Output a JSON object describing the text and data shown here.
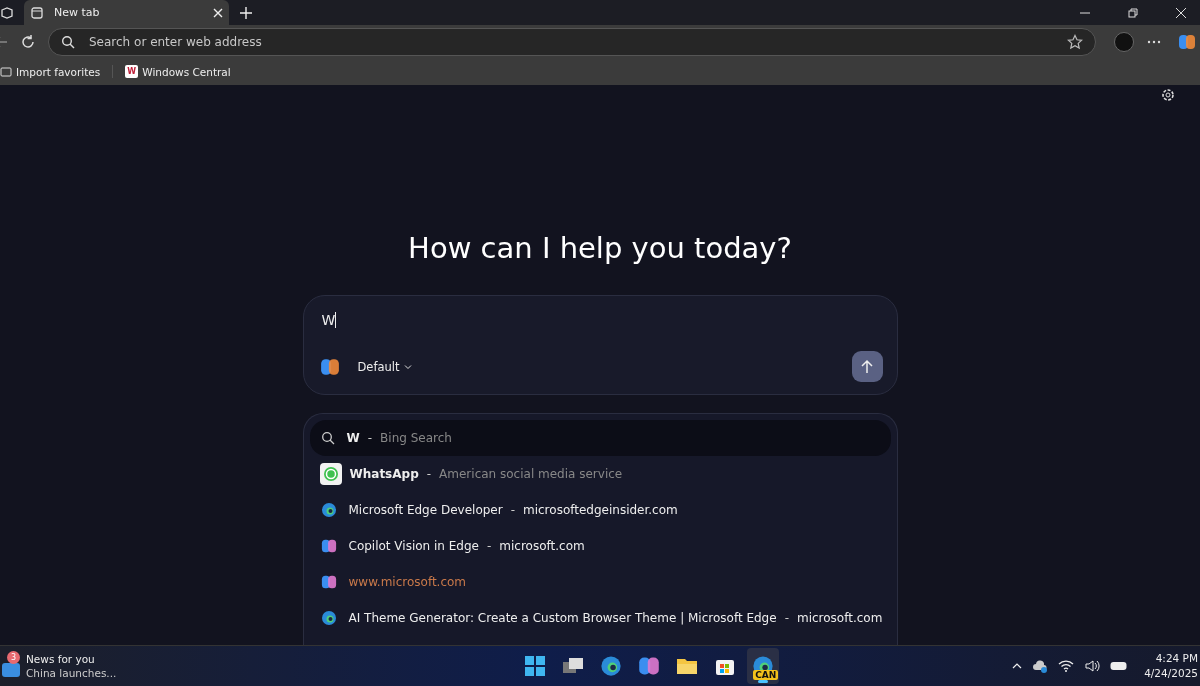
{
  "tabs": [
    {
      "title": "New tab",
      "selected": true
    }
  ],
  "address_bar": {
    "placeholder": "Search or enter web address"
  },
  "favorites": [
    {
      "label": "Import favorites",
      "kind": "import"
    },
    {
      "label": "Windows Central",
      "kind": "site",
      "badge": "W"
    }
  ],
  "heading": "How can I help you today?",
  "composer": {
    "value": "W",
    "mode": "Default"
  },
  "suggestions": [
    {
      "kind": "query",
      "title": "W",
      "separator": "-",
      "detail": "Bing Search",
      "selected": true
    },
    {
      "kind": "entity",
      "title": "WhatsApp",
      "separator": "-",
      "detail": "American social media service",
      "selected": false
    },
    {
      "kind": "edge",
      "title": "Microsoft Edge Developer",
      "separator": "-",
      "detail": "microsoftedgeinsider.com",
      "selected": false
    },
    {
      "kind": "copilot",
      "title": "Copilot Vision in Edge",
      "separator": "-",
      "detail": "microsoft.com",
      "selected": false
    },
    {
      "kind": "address",
      "title": "www.microsoft.com",
      "selected": false
    },
    {
      "kind": "edge",
      "title": "AI Theme Generator: Create a Custom Browser Theme | Microsoft Edge",
      "separator": "-",
      "detail": "microsoft.com",
      "selected": false
    }
  ],
  "taskbar": {
    "news": {
      "title": "News for you",
      "subtitle": "China launches...",
      "badge": "3"
    },
    "apps": [
      {
        "kind": "start",
        "selected": false
      },
      {
        "kind": "taskview",
        "selected": false
      },
      {
        "kind": "edge",
        "selected": false
      },
      {
        "kind": "copilot",
        "selected": false
      },
      {
        "kind": "folder",
        "selected": false
      },
      {
        "kind": "store",
        "selected": false
      },
      {
        "kind": "canary",
        "selected": true,
        "badge": "CAN"
      }
    ],
    "time": "4:24 PM",
    "date": "4/24/2025"
  }
}
